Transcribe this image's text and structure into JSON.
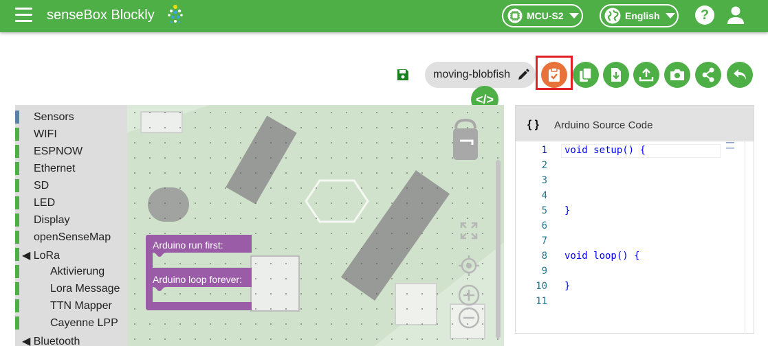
{
  "header": {
    "title": "senseBox Blockly",
    "board_label": "MCU-S2",
    "language_label": "English",
    "help_label": "?",
    "brand_color": "#4eaf47"
  },
  "toolbar": {
    "project_name": "moving-blobfish",
    "code_toggle_label": "</>",
    "icons": [
      "save-icon",
      "edit-icon",
      "clipboard-check-icon",
      "copy-icon",
      "download-icon",
      "upload-icon",
      "camera-icon",
      "share-icon",
      "undo-icon"
    ],
    "highlight_color": "#e21f26",
    "accent_color": "#e8733a"
  },
  "toolbox": {
    "categories": [
      {
        "label": "Sensors"
      },
      {
        "label": "WIFI"
      },
      {
        "label": "ESPNOW"
      },
      {
        "label": "Ethernet"
      },
      {
        "label": "SD"
      },
      {
        "label": "LED"
      },
      {
        "label": "Display"
      },
      {
        "label": "openSenseMap"
      },
      {
        "label": "◀  LoRa"
      },
      {
        "label": "Aktivierung"
      },
      {
        "label": "Lora Message"
      },
      {
        "label": "TTN Mapper"
      },
      {
        "label": "Cayenne LPP"
      },
      {
        "label": "◀ Bluetooth"
      }
    ]
  },
  "workspace": {
    "block": {
      "label_first": "Arduino run first:",
      "label_loop": "Arduino loop forever:",
      "color": "#9a5ca6"
    }
  },
  "code_panel": {
    "braces": "{ }",
    "title": "Arduino Source Code",
    "line_numbers": [
      "1",
      "2",
      "3",
      "4",
      "5",
      "6",
      "7",
      "8",
      "9",
      "10",
      "11"
    ],
    "lines": [
      "void setup() {",
      "",
      "",
      "",
      "}",
      "",
      "",
      "void loop() {",
      "",
      "}",
      ""
    ]
  }
}
